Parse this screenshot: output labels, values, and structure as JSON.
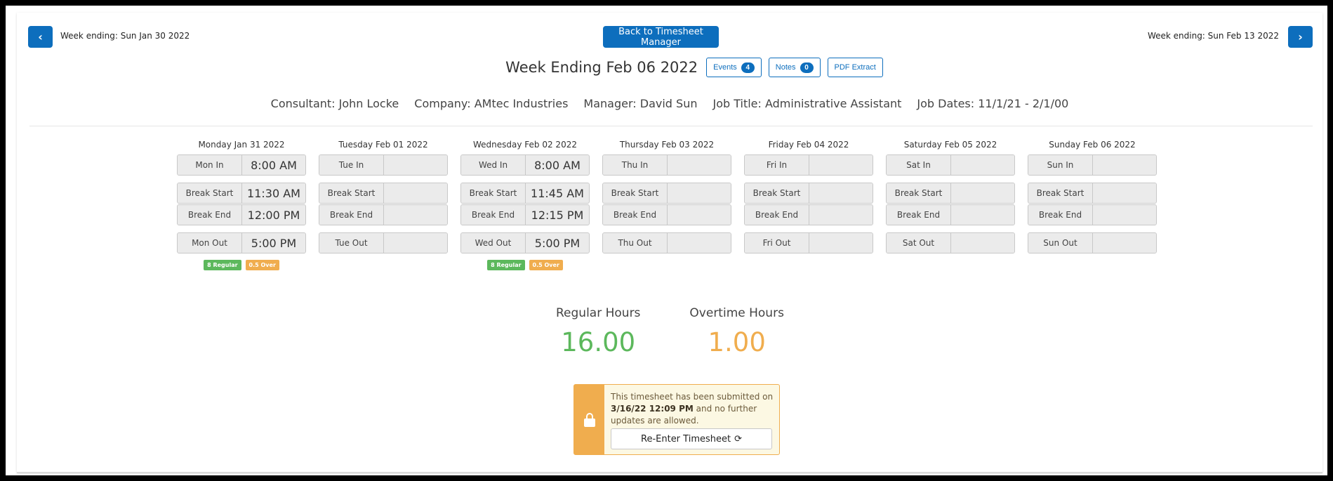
{
  "nav": {
    "prev_icon": "chevron-left-icon",
    "prev_label": "Week ending: Sun Jan 30 2022",
    "next_icon": "chevron-right-icon",
    "next_label": "Week ending: Sun Feb 13 2022",
    "back_button": "Back to Timesheet Manager",
    "prev_glyph": "‹",
    "next_glyph": "›"
  },
  "header": {
    "title": "Week Ending Feb 06 2022",
    "events_label": "Events",
    "events_count": "4",
    "notes_label": "Notes",
    "notes_count": "0",
    "pdf_label": "PDF Extract"
  },
  "info": {
    "consultant": "Consultant: John Locke",
    "company": "Company: AMtec Industries",
    "manager": "Manager: David Sun",
    "job_title": "Job Title: Administrative Assistant",
    "job_dates": "Job Dates: 11/1/21 - 2/1/00"
  },
  "days": [
    {
      "header": "Monday Jan 31 2022",
      "in_label": "Mon In",
      "in": "8:00 AM",
      "bs_label": "Break Start",
      "bs": "11:30 AM",
      "be_label": "Break End",
      "be": "12:00 PM",
      "out_label": "Mon Out",
      "out": "5:00 PM",
      "regular": "8 Regular",
      "over": "0.5 Over"
    },
    {
      "header": "Tuesday Feb 01 2022",
      "in_label": "Tue In",
      "in": "",
      "bs_label": "Break Start",
      "bs": "",
      "be_label": "Break End",
      "be": "",
      "out_label": "Tue Out",
      "out": "",
      "regular": "",
      "over": ""
    },
    {
      "header": "Wednesday Feb 02 2022",
      "in_label": "Wed In",
      "in": "8:00 AM",
      "bs_label": "Break Start",
      "bs": "11:45 AM",
      "be_label": "Break End",
      "be": "12:15 PM",
      "out_label": "Wed Out",
      "out": "5:00 PM",
      "regular": "8 Regular",
      "over": "0.5 Over"
    },
    {
      "header": "Thursday Feb 03 2022",
      "in_label": "Thu In",
      "in": "",
      "bs_label": "Break Start",
      "bs": "",
      "be_label": "Break End",
      "be": "",
      "out_label": "Thu Out",
      "out": "",
      "regular": "",
      "over": ""
    },
    {
      "header": "Friday Feb 04 2022",
      "in_label": "Fri In",
      "in": "",
      "bs_label": "Break Start",
      "bs": "",
      "be_label": "Break End",
      "be": "",
      "out_label": "Fri Out",
      "out": "",
      "regular": "",
      "over": ""
    },
    {
      "header": "Saturday Feb 05 2022",
      "in_label": "Sat In",
      "in": "",
      "bs_label": "Break Start",
      "bs": "",
      "be_label": "Break End",
      "be": "",
      "out_label": "Sat Out",
      "out": "",
      "regular": "",
      "over": ""
    },
    {
      "header": "Sunday Feb 06 2022",
      "in_label": "Sun In",
      "in": "",
      "bs_label": "Break Start",
      "bs": "",
      "be_label": "Break End",
      "be": "",
      "out_label": "Sun Out",
      "out": "",
      "regular": "",
      "over": ""
    }
  ],
  "totals": {
    "regular_label": "Regular Hours",
    "regular_value": "16.00",
    "overtime_label": "Overtime Hours",
    "overtime_value": "1.00"
  },
  "lock_notice": {
    "icon": "lock-icon",
    "text_before": "This timesheet has been submitted on",
    "timestamp": "3/16/22 12:09 PM",
    "text_after": "and no further updates are allowed.",
    "button_label": "Re-Enter Timesheet",
    "button_icon": "refresh-icon",
    "refresh_glyph": "⟳"
  },
  "colors": {
    "primary": "#0d6ebd",
    "success": "#5cb85c",
    "warning": "#f0ad4e"
  }
}
